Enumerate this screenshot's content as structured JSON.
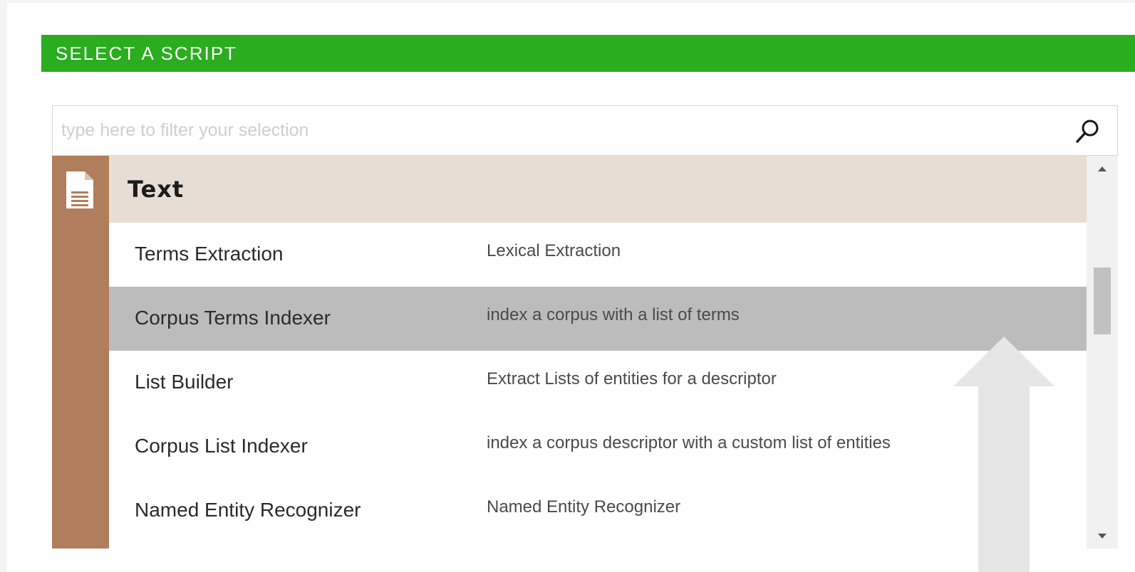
{
  "header": {
    "title": "SELECT A SCRIPT"
  },
  "search": {
    "placeholder": "type here to filter your selection",
    "value": ""
  },
  "category": {
    "name": "Text",
    "icon": "document-icon",
    "color": "#b07e5c",
    "header_bg": "#e8ddd4"
  },
  "scripts": [
    {
      "name": "Terms Extraction",
      "description": "Lexical Extraction",
      "selected": false
    },
    {
      "name": "Corpus Terms Indexer",
      "description": "index a corpus with a list of terms",
      "selected": true
    },
    {
      "name": "List Builder",
      "description": "Extract Lists of entities for a descriptor",
      "selected": false
    },
    {
      "name": "Corpus List Indexer",
      "description": "index a corpus descriptor with a custom list of entities",
      "selected": false
    },
    {
      "name": "Named Entity Recognizer",
      "description": "Named Entity Recognizer",
      "selected": false
    }
  ],
  "colors": {
    "accent": "#2aad1f",
    "selected_row": "#bcbcbc"
  },
  "icons": {
    "search": "search-icon",
    "scroll_up": "scroll-up-arrow-icon",
    "scroll_down": "scroll-down-arrow-icon",
    "overlay": "up-arrow-icon"
  }
}
